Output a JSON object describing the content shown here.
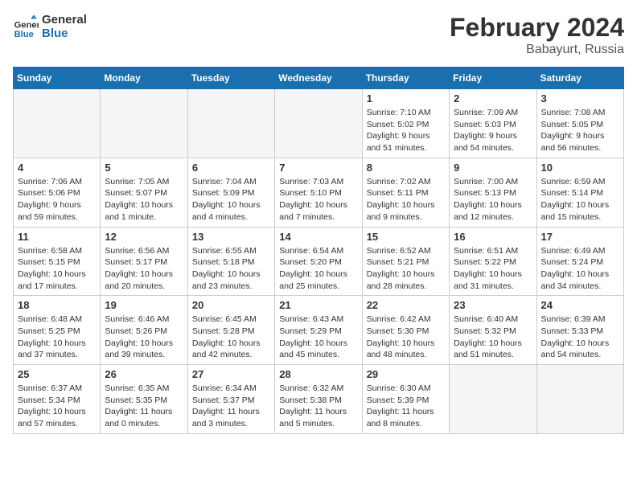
{
  "logo": {
    "line1": "General",
    "line2": "Blue"
  },
  "title": {
    "month_year": "February 2024",
    "location": "Babayurt, Russia"
  },
  "weekdays": [
    "Sunday",
    "Monday",
    "Tuesday",
    "Wednesday",
    "Thursday",
    "Friday",
    "Saturday"
  ],
  "weeks": [
    [
      {
        "day": "",
        "info": ""
      },
      {
        "day": "",
        "info": ""
      },
      {
        "day": "",
        "info": ""
      },
      {
        "day": "",
        "info": ""
      },
      {
        "day": "1",
        "info": "Sunrise: 7:10 AM\nSunset: 5:02 PM\nDaylight: 9 hours\nand 51 minutes."
      },
      {
        "day": "2",
        "info": "Sunrise: 7:09 AM\nSunset: 5:03 PM\nDaylight: 9 hours\nand 54 minutes."
      },
      {
        "day": "3",
        "info": "Sunrise: 7:08 AM\nSunset: 5:05 PM\nDaylight: 9 hours\nand 56 minutes."
      }
    ],
    [
      {
        "day": "4",
        "info": "Sunrise: 7:06 AM\nSunset: 5:06 PM\nDaylight: 9 hours\nand 59 minutes."
      },
      {
        "day": "5",
        "info": "Sunrise: 7:05 AM\nSunset: 5:07 PM\nDaylight: 10 hours\nand 1 minute."
      },
      {
        "day": "6",
        "info": "Sunrise: 7:04 AM\nSunset: 5:09 PM\nDaylight: 10 hours\nand 4 minutes."
      },
      {
        "day": "7",
        "info": "Sunrise: 7:03 AM\nSunset: 5:10 PM\nDaylight: 10 hours\nand 7 minutes."
      },
      {
        "day": "8",
        "info": "Sunrise: 7:02 AM\nSunset: 5:11 PM\nDaylight: 10 hours\nand 9 minutes."
      },
      {
        "day": "9",
        "info": "Sunrise: 7:00 AM\nSunset: 5:13 PM\nDaylight: 10 hours\nand 12 minutes."
      },
      {
        "day": "10",
        "info": "Sunrise: 6:59 AM\nSunset: 5:14 PM\nDaylight: 10 hours\nand 15 minutes."
      }
    ],
    [
      {
        "day": "11",
        "info": "Sunrise: 6:58 AM\nSunset: 5:15 PM\nDaylight: 10 hours\nand 17 minutes."
      },
      {
        "day": "12",
        "info": "Sunrise: 6:56 AM\nSunset: 5:17 PM\nDaylight: 10 hours\nand 20 minutes."
      },
      {
        "day": "13",
        "info": "Sunrise: 6:55 AM\nSunset: 5:18 PM\nDaylight: 10 hours\nand 23 minutes."
      },
      {
        "day": "14",
        "info": "Sunrise: 6:54 AM\nSunset: 5:20 PM\nDaylight: 10 hours\nand 25 minutes."
      },
      {
        "day": "15",
        "info": "Sunrise: 6:52 AM\nSunset: 5:21 PM\nDaylight: 10 hours\nand 28 minutes."
      },
      {
        "day": "16",
        "info": "Sunrise: 6:51 AM\nSunset: 5:22 PM\nDaylight: 10 hours\nand 31 minutes."
      },
      {
        "day": "17",
        "info": "Sunrise: 6:49 AM\nSunset: 5:24 PM\nDaylight: 10 hours\nand 34 minutes."
      }
    ],
    [
      {
        "day": "18",
        "info": "Sunrise: 6:48 AM\nSunset: 5:25 PM\nDaylight: 10 hours\nand 37 minutes."
      },
      {
        "day": "19",
        "info": "Sunrise: 6:46 AM\nSunset: 5:26 PM\nDaylight: 10 hours\nand 39 minutes."
      },
      {
        "day": "20",
        "info": "Sunrise: 6:45 AM\nSunset: 5:28 PM\nDaylight: 10 hours\nand 42 minutes."
      },
      {
        "day": "21",
        "info": "Sunrise: 6:43 AM\nSunset: 5:29 PM\nDaylight: 10 hours\nand 45 minutes."
      },
      {
        "day": "22",
        "info": "Sunrise: 6:42 AM\nSunset: 5:30 PM\nDaylight: 10 hours\nand 48 minutes."
      },
      {
        "day": "23",
        "info": "Sunrise: 6:40 AM\nSunset: 5:32 PM\nDaylight: 10 hours\nand 51 minutes."
      },
      {
        "day": "24",
        "info": "Sunrise: 6:39 AM\nSunset: 5:33 PM\nDaylight: 10 hours\nand 54 minutes."
      }
    ],
    [
      {
        "day": "25",
        "info": "Sunrise: 6:37 AM\nSunset: 5:34 PM\nDaylight: 10 hours\nand 57 minutes."
      },
      {
        "day": "26",
        "info": "Sunrise: 6:35 AM\nSunset: 5:35 PM\nDaylight: 11 hours\nand 0 minutes."
      },
      {
        "day": "27",
        "info": "Sunrise: 6:34 AM\nSunset: 5:37 PM\nDaylight: 11 hours\nand 3 minutes."
      },
      {
        "day": "28",
        "info": "Sunrise: 6:32 AM\nSunset: 5:38 PM\nDaylight: 11 hours\nand 5 minutes."
      },
      {
        "day": "29",
        "info": "Sunrise: 6:30 AM\nSunset: 5:39 PM\nDaylight: 11 hours\nand 8 minutes."
      },
      {
        "day": "",
        "info": ""
      },
      {
        "day": "",
        "info": ""
      }
    ]
  ]
}
